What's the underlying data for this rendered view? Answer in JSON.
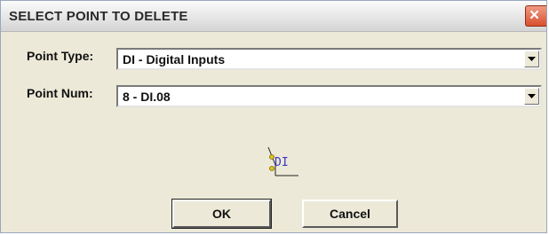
{
  "window": {
    "title": "SELECT POINT TO DELETE"
  },
  "fields": {
    "point_type": {
      "label": "Point Type:",
      "value": "DI - Digital Inputs"
    },
    "point_num": {
      "label": "Point Num:",
      "value": "8 - DI.08"
    }
  },
  "icon": {
    "name": "digital-input-point-icon",
    "text": "DI"
  },
  "buttons": {
    "ok": "OK",
    "cancel": "Cancel"
  },
  "colors": {
    "dialog_bg": "#ece9d8",
    "close_red": "#d9502e",
    "icon_text": "#3b33c4",
    "icon_node": "#e0c21a"
  }
}
